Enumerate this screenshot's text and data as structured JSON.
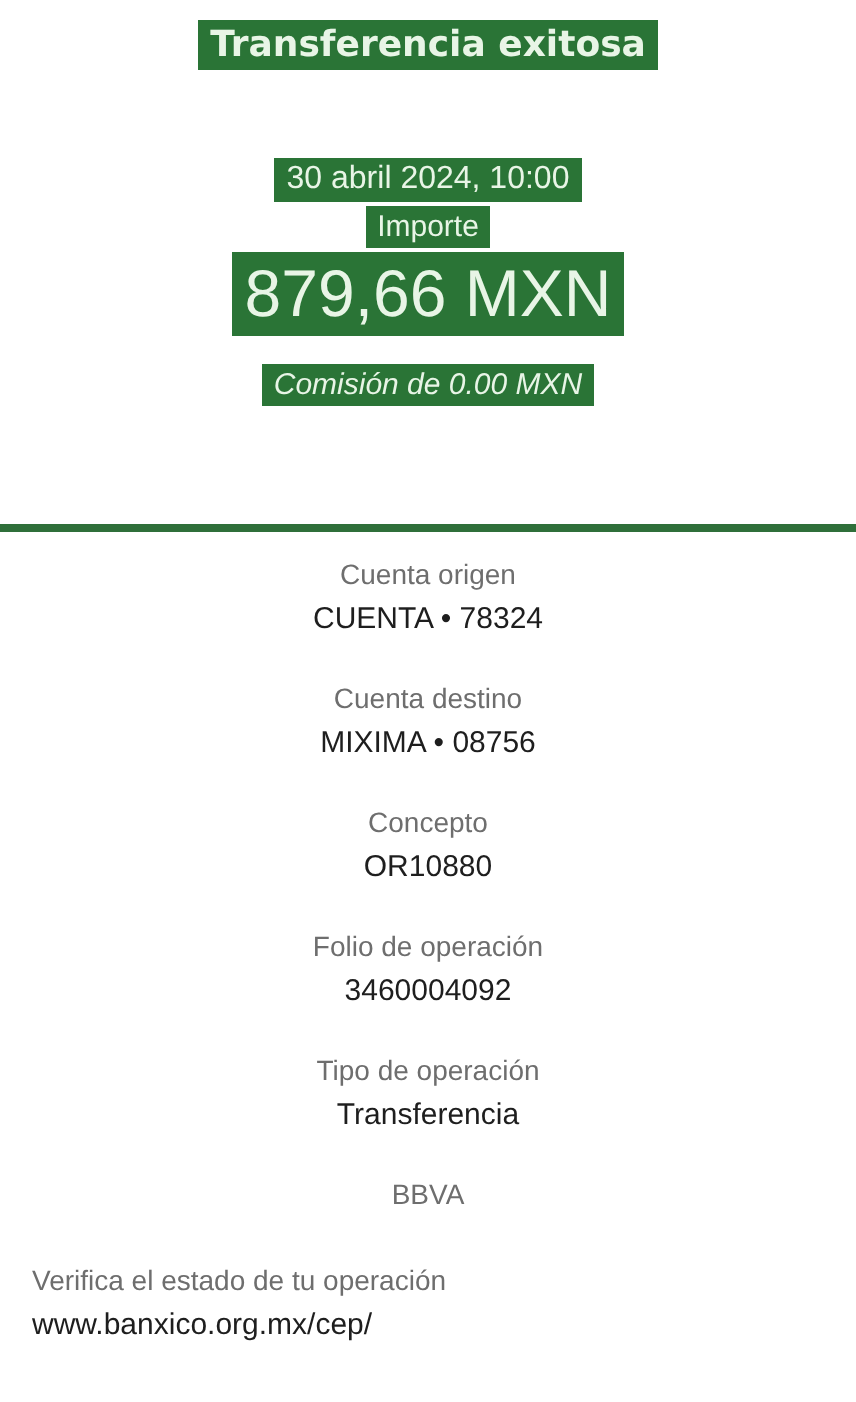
{
  "header": {
    "title": "Transferencia exitosa",
    "date": "30 abril 2024, 10:00",
    "amount_label": "Importe",
    "amount": "879,66 MXN",
    "commission": "Comisión de 0.00 MXN"
  },
  "details": [
    {
      "label": "Cuenta origen",
      "value": "CUENTA • 78324"
    },
    {
      "label": "Cuenta destino",
      "value": "MIXIMA • 08756"
    },
    {
      "label": "Concepto",
      "value": "OR10880"
    },
    {
      "label": "Folio de operación",
      "value": "3460004092"
    },
    {
      "label": "Tipo de operación",
      "value": "Transferencia"
    }
  ],
  "bank": "BBVA",
  "footer": {
    "text": "Verifica el estado de tu operación",
    "link": "www.banxico.org.mx/cep/"
  }
}
